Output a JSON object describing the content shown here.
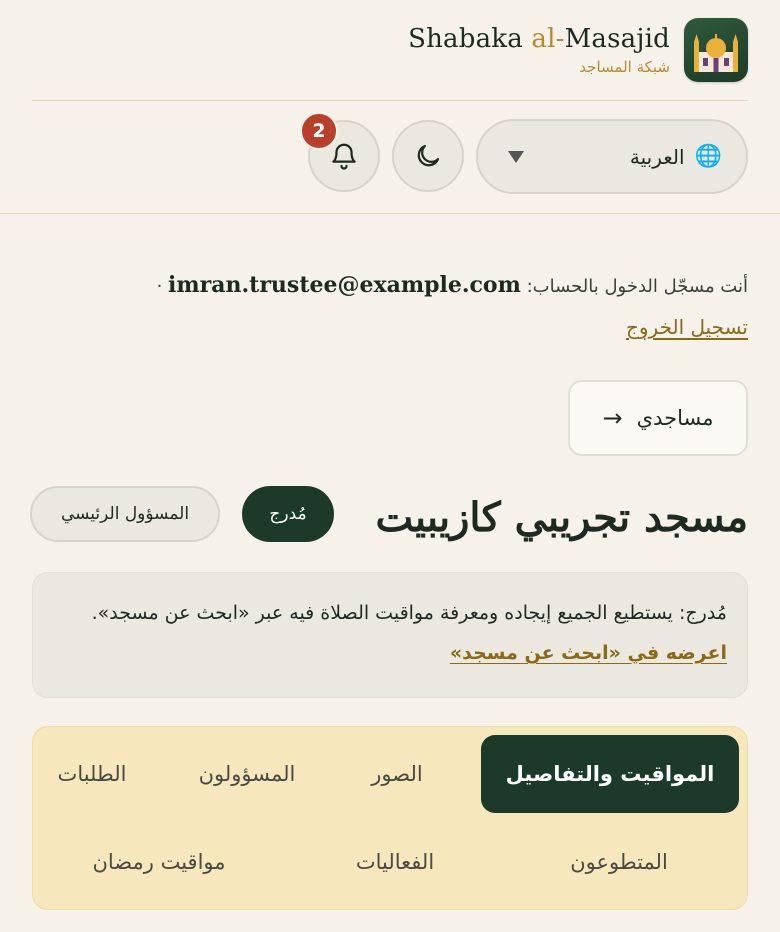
{
  "brand": {
    "name_prefix": "Shabaka ",
    "name_al": "al-",
    "name_suffix": "Masajid",
    "name_ar": "شبكة المساجد",
    "logo_icon": "mosque-icon",
    "accent_color": "#b88a2e",
    "primary_color": "#1c3a2a"
  },
  "toolbar": {
    "language": {
      "icon": "globe-icon",
      "label": "العربية"
    },
    "theme_icon": "moon-icon",
    "notifications": {
      "icon": "bell-icon",
      "count": "2",
      "badge_color": "#b8402a"
    }
  },
  "session": {
    "prefix": "أنت مسجّل الدخول بالحساب:",
    "email": "imran.trustee@example.com",
    "separator": "·",
    "logout_label": "تسجيل الخروج"
  },
  "nav": {
    "my_mosques_label": "مساجدي",
    "arrow_icon": "→"
  },
  "mosque": {
    "title": "مسجد تجريبي كازيبيت",
    "status_badge": "مُدرج",
    "role_badge": "المسؤول الرئيسي"
  },
  "notice": {
    "text": "مُدرج: يستطيع الجميع إيجاده ومعرفة مواقيت الصلاة فيه عبر «ابحث عن مسجد».",
    "link_label": "اعرضه في «ابحث عن مسجد»"
  },
  "tabs": [
    {
      "label": "المواقيت والتفاصيل",
      "active": true
    },
    {
      "label": "الصور",
      "active": false
    },
    {
      "label": "المسؤولون",
      "active": false
    },
    {
      "label": "الطلبات",
      "active": false
    },
    {
      "label": "المتطوعون",
      "active": false
    },
    {
      "label": "الفعاليات",
      "active": false
    },
    {
      "label": "مواقيت رمضان",
      "active": false
    }
  ]
}
